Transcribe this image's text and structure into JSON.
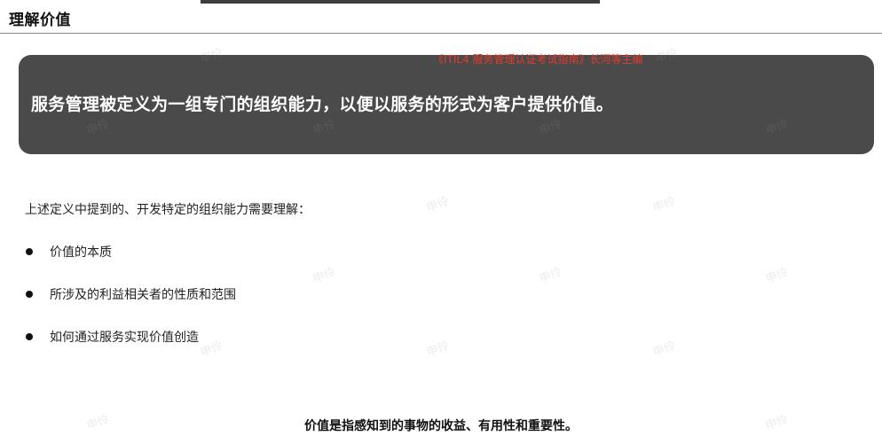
{
  "page": {
    "title": "理解价值",
    "source_note": "《ITIL4 服务管理认证考试指南》长河等主编",
    "banner_text": "服务管理被定义为一组专门的组织能力，以便以服务的形式为客户提供价值。",
    "intro": "上述定义中提到的、开发特定的组织能力需要理解：",
    "bullets": [
      "价值的本质",
      "所涉及的利益相关者的性质和范围",
      "如何通过服务实现价值创造"
    ],
    "definition": "价值是指感知到的事物的收益、有用性和重要性。"
  },
  "watermark": {
    "text": "申伶"
  },
  "colors": {
    "banner_bg": "#4a4a4a",
    "source_note": "#e23b2e",
    "top_bar": "#3d3d3d"
  }
}
